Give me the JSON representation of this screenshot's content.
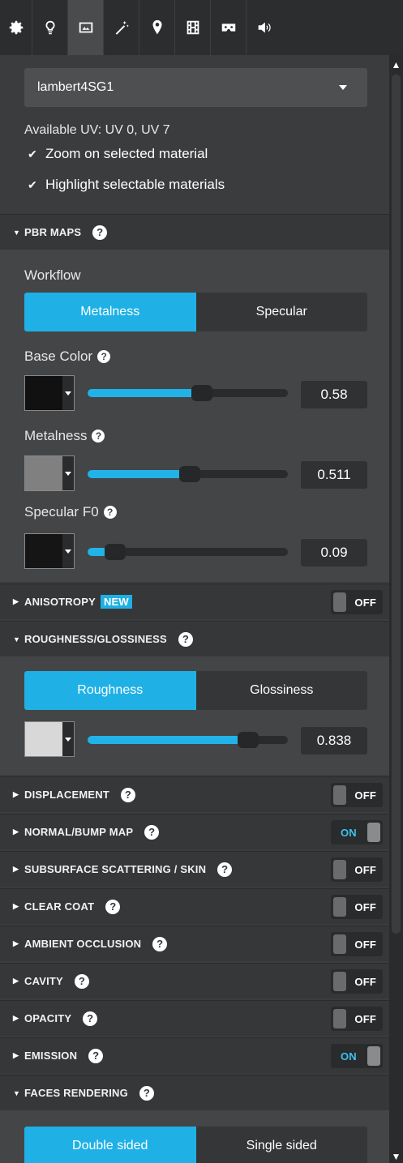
{
  "toolbar": {
    "icons": [
      "gear-icon",
      "lightbulb-icon",
      "image-icon",
      "magic-wand-icon",
      "map-pin-icon",
      "film-icon",
      "vr-headset-icon",
      "speaker-icon"
    ],
    "active_index": 2
  },
  "material": {
    "selected": "lambert4SG1",
    "available_uv": "Available UV: UV 0, UV 7",
    "zoom_label": "Zoom on selected material",
    "highlight_label": "Highlight selectable materials"
  },
  "pbr": {
    "title": "PBR MAPS",
    "workflow_label": "Workflow",
    "workflow_options": [
      "Metalness",
      "Specular"
    ],
    "workflow_selected": "Metalness",
    "base_color": {
      "label": "Base Color",
      "value": "0.58",
      "fraction": 0.58,
      "swatch": "#111111"
    },
    "metalness": {
      "label": "Metalness",
      "value": "0.511",
      "fraction": 0.511,
      "swatch": "#808080"
    },
    "specular_f0": {
      "label": "Specular F0",
      "value": "0.09",
      "fraction": 0.09,
      "swatch": "#151515"
    }
  },
  "anisotropy": {
    "title": "ANISOTROPY",
    "badge": "NEW",
    "state": "OFF"
  },
  "roughness": {
    "title": "ROUGHNESS/GLOSSINESS",
    "options": [
      "Roughness",
      "Glossiness"
    ],
    "selected": "Roughness",
    "value": "0.838",
    "fraction": 0.838,
    "swatch": "#d8d8d8"
  },
  "sections": [
    {
      "title": "DISPLACEMENT",
      "state": "OFF"
    },
    {
      "title": "NORMAL/BUMP MAP",
      "state": "ON"
    },
    {
      "title": "SUBSURFACE SCATTERING / SKIN",
      "state": "OFF"
    },
    {
      "title": "CLEAR COAT",
      "state": "OFF"
    },
    {
      "title": "AMBIENT OCCLUSION",
      "state": "OFF"
    },
    {
      "title": "CAVITY",
      "state": "OFF"
    },
    {
      "title": "OPACITY",
      "state": "OFF"
    },
    {
      "title": "EMISSION",
      "state": "ON"
    }
  ],
  "faces": {
    "title": "FACES RENDERING",
    "options": [
      "Double sided",
      "Single sided"
    ],
    "selected": "Double sided"
  },
  "help_glyph": "?",
  "colors": {
    "accent": "#1fb1e6",
    "on_text": "#39c3ee"
  }
}
